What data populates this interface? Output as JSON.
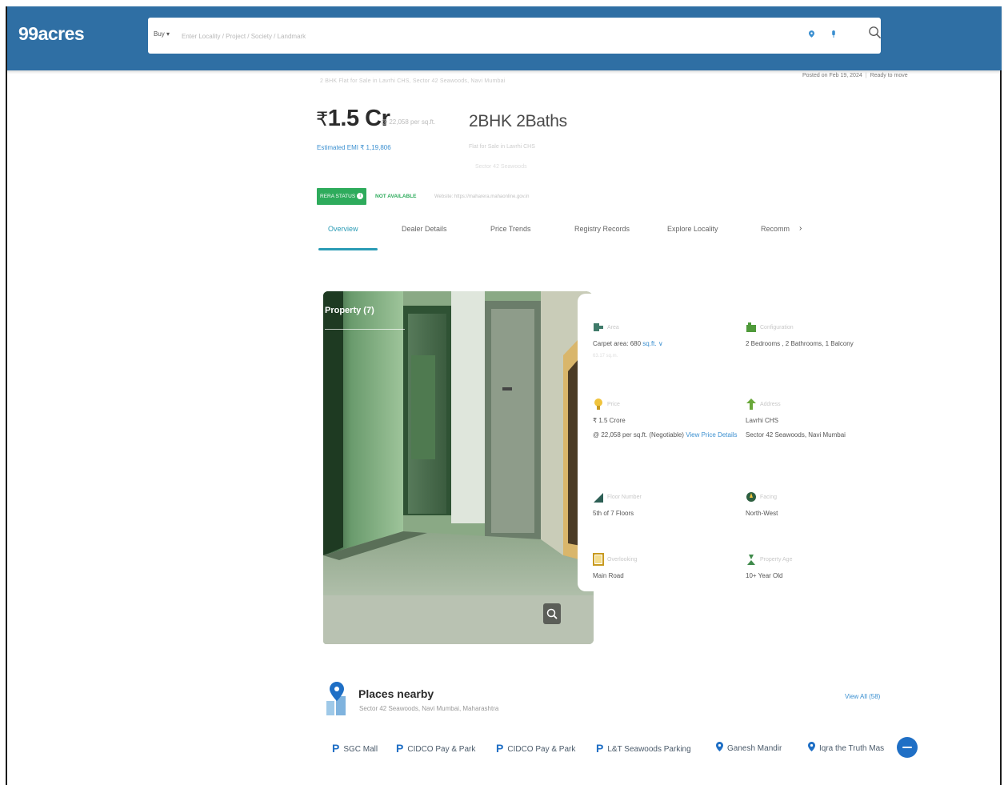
{
  "header": {
    "logo": "99acres",
    "buy_label": "Buy ▾",
    "search_placeholder": "Enter Locality / Project / Society / Landmark"
  },
  "listing": {
    "title_line": "2 BHK Flat for Sale in Lavrhi CHS, Sector 42 Seawoods, Navi Mumbai",
    "posted": "Posted on Feb 19, 2024",
    "status": "Ready to move",
    "price": "1.5 Cr",
    "price_rupee": "₹",
    "price_sub": "@ 22,058 per sq.ft.",
    "emi": "Estimated EMI ₹ 1,19,806",
    "config": "2BHK 2Baths",
    "config_sub1": "Flat for Sale in Lavrhi CHS",
    "config_sub2": "Sector 42 Seawoods",
    "rera_badge": "RERA STATUS",
    "rera_info": "i",
    "rera_status": "NOT AVAILABLE",
    "rera_note": "Website: https://maharera.mahaonline.gov.in"
  },
  "tabs": [
    {
      "label": "Overview"
    },
    {
      "label": "Dealer Details"
    },
    {
      "label": "Price Trends"
    },
    {
      "label": "Registry Records"
    },
    {
      "label": "Explore Locality"
    },
    {
      "label": "Recomm"
    }
  ],
  "tab_chevron": "›",
  "gallery": {
    "label": "Property (7)"
  },
  "details": {
    "area": {
      "label": "Area",
      "value": "Carpet area: 680",
      "unit": "sq.ft. ∨",
      "faint": "63.17 sq.m."
    },
    "configuration": {
      "label": "Configuration",
      "value": "2 Bedrooms , 2 Bathrooms, 1 Balcony"
    },
    "price": {
      "label": "Price",
      "value": "₹ 1.5 Crore",
      "value2": "@ 22,058 per sq.ft. (Negotiable)",
      "link": "View Price Details"
    },
    "address": {
      "label": "Address",
      "value": "Lavrhi CHS",
      "value2": "Sector 42 Seawoods, Navi Mumbai"
    },
    "floor": {
      "label": "Floor Number",
      "value": "5th of 7 Floors"
    },
    "facing": {
      "label": "Facing",
      "value": "North-West"
    },
    "overlooking": {
      "label": "Overlooking",
      "value": "Main Road"
    },
    "age": {
      "label": "Property Age",
      "value": "10+ Year Old"
    }
  },
  "places": {
    "title": "Places nearby",
    "subtitle": "Sector 42 Seawoods, Navi Mumbai, Maharashtra",
    "view_all": "View All (58)",
    "chips": [
      {
        "label": "SGC Mall",
        "kind": "parking"
      },
      {
        "label": "CIDCO Pay & Park",
        "kind": "parking"
      },
      {
        "label": "CIDCO Pay & Park",
        "kind": "parking"
      },
      {
        "label": "L&T Seawoods Parking",
        "kind": "parking"
      },
      {
        "label": "Ganesh Mandir",
        "kind": "place"
      },
      {
        "label": "Iqra the Truth Mas",
        "kind": "place"
      }
    ],
    "parking_glyph": "P"
  }
}
